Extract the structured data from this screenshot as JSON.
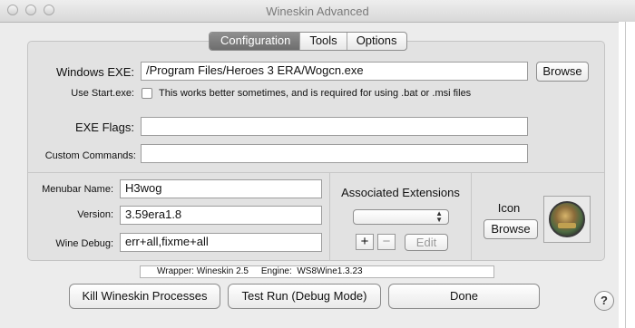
{
  "window": {
    "title": "Wineskin Advanced"
  },
  "tabs": [
    {
      "label": "Configuration",
      "selected": true
    },
    {
      "label": "Tools",
      "selected": false
    },
    {
      "label": "Options",
      "selected": false
    }
  ],
  "exe": {
    "label": "Windows EXE:",
    "value": "/Program Files/Heroes 3 ERA/Wogcn.exe",
    "browse": "Browse"
  },
  "use_start_exe": {
    "label": "Use Start.exe:",
    "description": "This works better sometimes, and is required for using .bat or .msi files",
    "checked": false
  },
  "exe_flags": {
    "label": "EXE Flags:",
    "value": ""
  },
  "custom_commands": {
    "label": "Custom Commands:",
    "value": ""
  },
  "menubar_name": {
    "label": "Menubar Name:",
    "value": "H3wog"
  },
  "version": {
    "label": "Version:",
    "value": "3.59era1.8"
  },
  "wine_debug": {
    "label": "Wine Debug:",
    "value": "err+all,fixme+all"
  },
  "associated_extensions": {
    "title": "Associated Extensions",
    "selected": "",
    "add": "+",
    "remove": "−",
    "edit": "Edit"
  },
  "icon": {
    "label": "Icon",
    "browse": "Browse",
    "image": "heroes-app-icon"
  },
  "status": {
    "text": "Wrapper: Wineskin 2.5     Engine:  WS8Wine1.3.23"
  },
  "buttons": {
    "kill": "Kill Wineskin Processes",
    "test_run": "Test Run (Debug Mode)",
    "done": "Done",
    "help": "?"
  }
}
